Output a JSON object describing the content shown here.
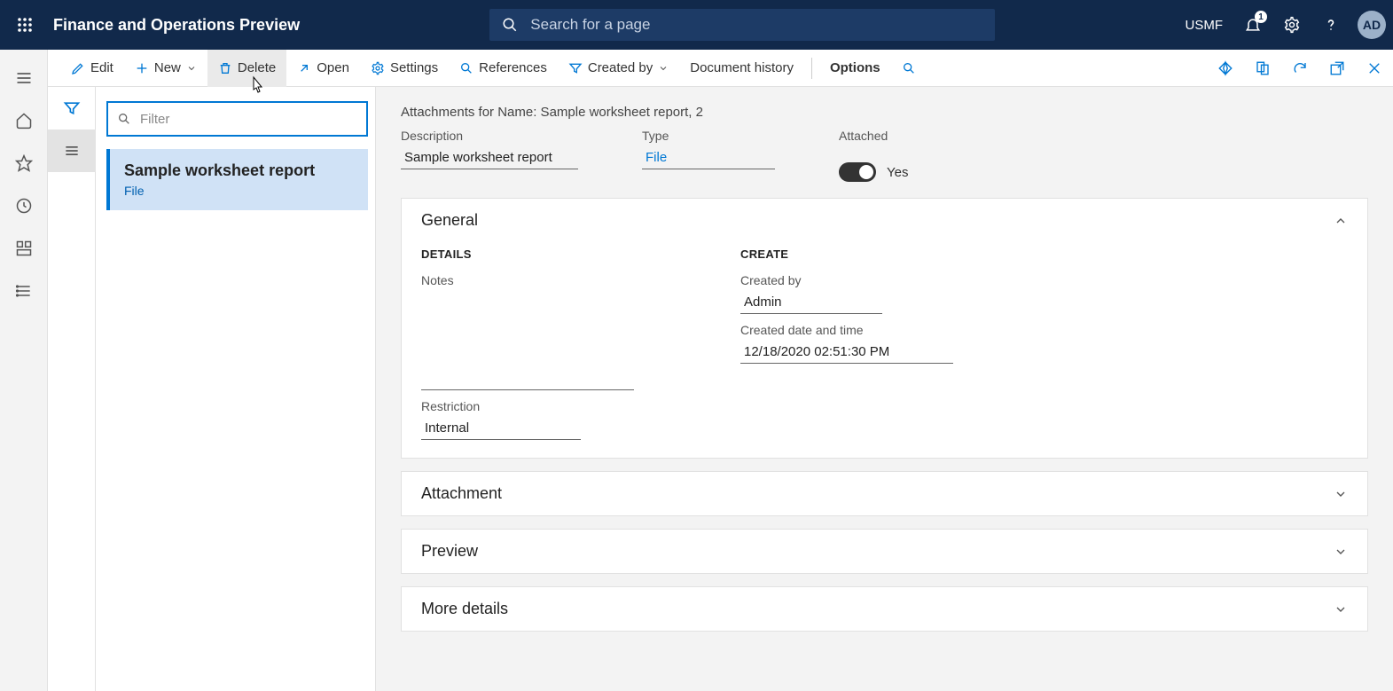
{
  "topbar": {
    "title": "Finance and Operations Preview",
    "search_placeholder": "Search for a page",
    "company": "USMF",
    "notif_count": "1",
    "avatar": "AD"
  },
  "actions": {
    "edit": "Edit",
    "new": "New",
    "delete": "Delete",
    "open": "Open",
    "settings": "Settings",
    "references": "References",
    "created_by": "Created by",
    "doc_history": "Document history",
    "options": "Options"
  },
  "list": {
    "filter_placeholder": "Filter",
    "item": {
      "title": "Sample worksheet report",
      "type": "File"
    }
  },
  "detail": {
    "title": "Attachments for Name: Sample worksheet report, 2",
    "description_label": "Description",
    "description_value": "Sample worksheet report",
    "type_label": "Type",
    "type_value": "File",
    "attached_label": "Attached",
    "attached_value": "Yes",
    "sections": {
      "general": "General",
      "attachment": "Attachment",
      "preview": "Preview",
      "more": "More details"
    },
    "general": {
      "details_head": "DETAILS",
      "create_head": "CREATE",
      "notes_label": "Notes",
      "restriction_label": "Restriction",
      "restriction_value": "Internal",
      "created_by_label": "Created by",
      "created_by_value": "Admin",
      "created_dt_label": "Created date and time",
      "created_dt_value": "12/18/2020 02:51:30 PM"
    }
  }
}
